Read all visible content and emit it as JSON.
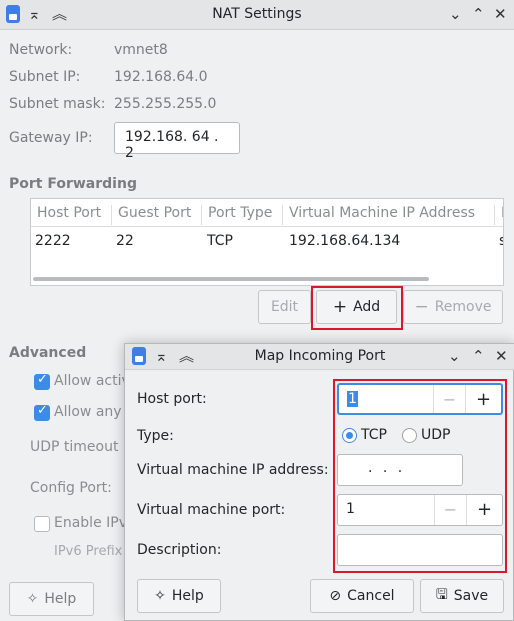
{
  "window": {
    "title": "NAT Settings"
  },
  "network": {
    "network_label": "Network:",
    "network_value": "vmnet8",
    "subnet_ip_label": "Subnet IP:",
    "subnet_ip_value": "192.168.64.0",
    "subnet_mask_label": "Subnet mask:",
    "subnet_mask_value": "255.255.255.0",
    "gateway_label": "Gateway IP:",
    "gateway_value": "192.168. 64 .  2"
  },
  "port_forwarding": {
    "title": "Port Forwarding",
    "columns": [
      "Host Port",
      "Guest Port",
      "Port Type",
      "Virtual Machine IP Address",
      "D"
    ],
    "rows": [
      {
        "host_port": "2222",
        "guest_port": "22",
        "port_type": "TCP",
        "vm_ip": "192.168.64.134",
        "desc": "s"
      }
    ],
    "edit_label": "Edit",
    "add_label": "Add",
    "remove_label": "Remove"
  },
  "advanced": {
    "title": "Advanced",
    "allow_active_label": "Allow activ",
    "allow_any_label": "Allow any",
    "udp_timeout_label": "UDP timeout",
    "config_port_label": "Config Port:",
    "enable_ipv6_label": "Enable IPv",
    "ipv6_prefix_label": "IPv6 Prefix"
  },
  "footer": {
    "help_label": "Help"
  },
  "dialog": {
    "title": "Map Incoming Port",
    "host_port_label": "Host port:",
    "host_port_value": "1",
    "type_label": "Type:",
    "tcp_label": "TCP",
    "udp_label": "UDP",
    "selected_type": "TCP",
    "vm_ip_label": "Virtual machine IP address:",
    "vm_ip_value": ".   .   .",
    "vm_port_label": "Virtual machine port:",
    "vm_port_value": "1",
    "description_label": "Description:",
    "description_value": "",
    "help_label": "Help",
    "cancel_label": "Cancel",
    "save_label": "Save"
  },
  "colors": {
    "accent": "#3d8be8",
    "highlight_box": "#d7192a"
  }
}
